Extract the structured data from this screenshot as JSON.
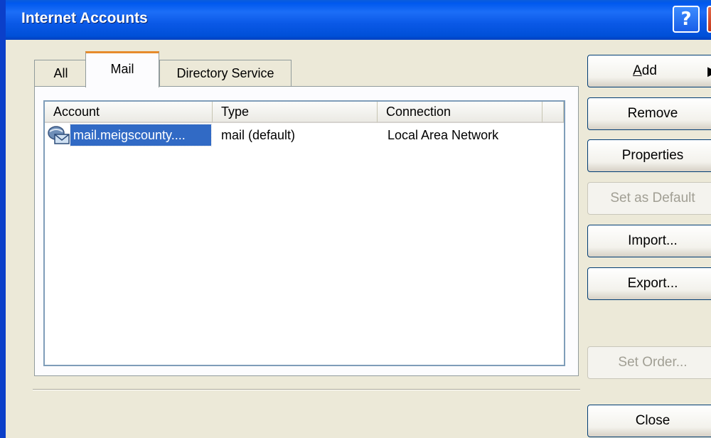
{
  "window": {
    "title": "Internet Accounts",
    "help_label": "?",
    "close_label": "X"
  },
  "tabs": [
    {
      "label": "All",
      "selected": false
    },
    {
      "label": "Mail",
      "selected": true
    },
    {
      "label": "Directory Service",
      "selected": false
    }
  ],
  "list": {
    "columns": [
      "Account",
      "Type",
      "Connection",
      ""
    ],
    "rows": [
      {
        "icon": "mail-account-icon",
        "account": "mail.meigscounty....",
        "type": "mail (default)",
        "connection": "Local Area Network",
        "selected": true
      }
    ]
  },
  "buttons": {
    "add": {
      "label_underlined": "A",
      "label_rest": "dd",
      "submenu_arrow": "▶"
    },
    "remove": "Remove",
    "properties": "Properties",
    "set_default": "Set as Default",
    "import": "Import...",
    "export": "Export...",
    "set_order": "Set Order...",
    "close": "Close"
  },
  "colors": {
    "selection": "#316ac5",
    "titlebar": "#0058ee",
    "dialog_bg": "#ece9d8"
  }
}
